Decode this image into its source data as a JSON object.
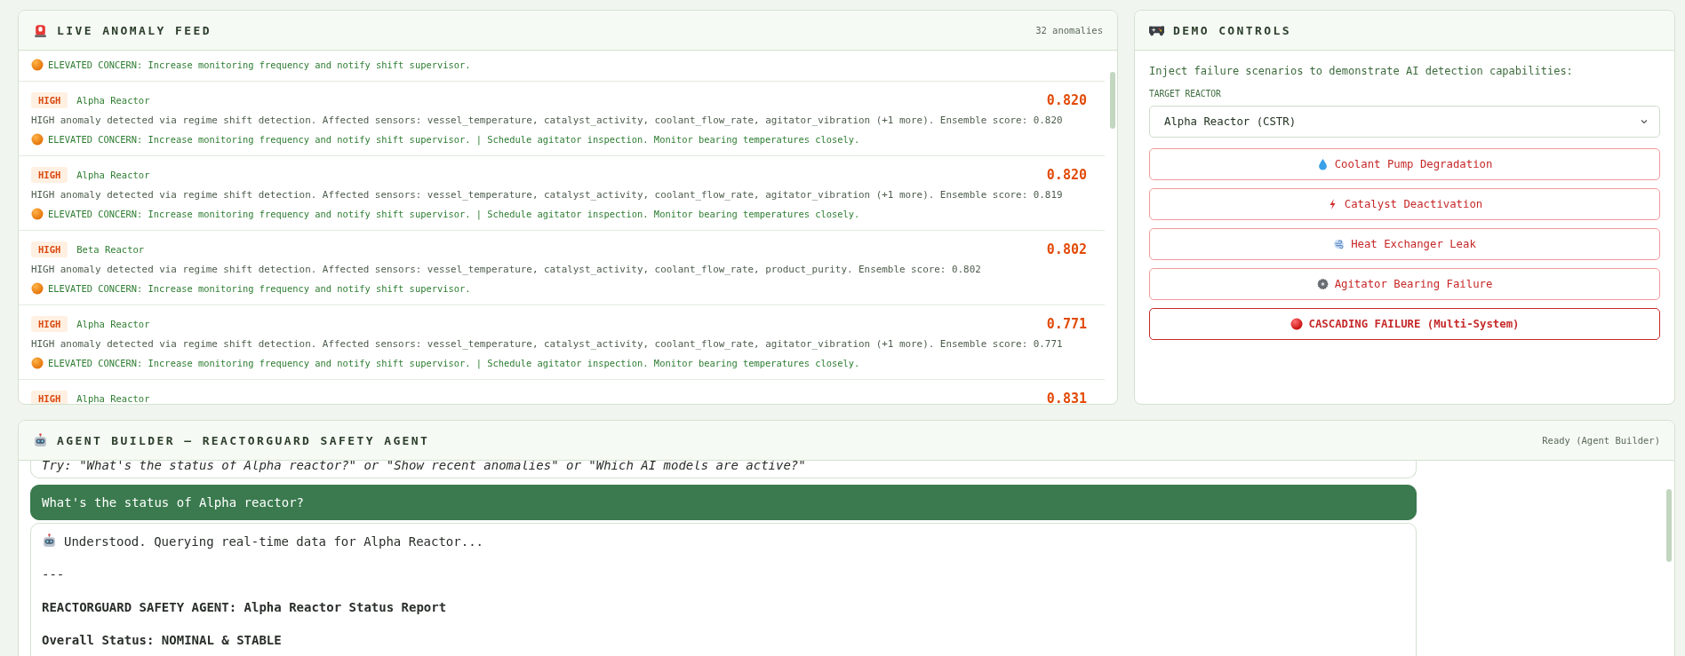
{
  "feed": {
    "title": "LIVE ANOMALY FEED",
    "count": "32 anomalies",
    "items": [
      {
        "concern": "ELEVATED CONCERN: Increase monitoring frequency and notify shift supervisor."
      },
      {
        "severity": "HIGH",
        "reactor": "Alpha Reactor",
        "score": "0.820",
        "description": "HIGH anomaly detected via regime shift detection. Affected sensors: vessel_temperature, catalyst_activity, coolant_flow_rate, agitator_vibration (+1 more). Ensemble score: 0.820",
        "concern": "ELEVATED CONCERN: Increase monitoring frequency and notify shift supervisor. | Schedule agitator inspection. Monitor bearing temperatures closely."
      },
      {
        "severity": "HIGH",
        "reactor": "Alpha Reactor",
        "score": "0.820",
        "description": "HIGH anomaly detected via regime shift detection. Affected sensors: vessel_temperature, catalyst_activity, coolant_flow_rate, agitator_vibration (+1 more). Ensemble score: 0.819",
        "concern": "ELEVATED CONCERN: Increase monitoring frequency and notify shift supervisor. | Schedule agitator inspection. Monitor bearing temperatures closely."
      },
      {
        "severity": "HIGH",
        "reactor": "Beta Reactor",
        "score": "0.802",
        "description": "HIGH anomaly detected via regime shift detection. Affected sensors: vessel_temperature, catalyst_activity, coolant_flow_rate, product_purity. Ensemble score: 0.802",
        "concern": "ELEVATED CONCERN: Increase monitoring frequency and notify shift supervisor."
      },
      {
        "severity": "HIGH",
        "reactor": "Alpha Reactor",
        "score": "0.771",
        "description": "HIGH anomaly detected via regime shift detection. Affected sensors: vessel_temperature, catalyst_activity, coolant_flow_rate, agitator_vibration (+1 more). Ensemble score: 0.771",
        "concern": "ELEVATED CONCERN: Increase monitoring frequency and notify shift supervisor. | Schedule agitator inspection. Monitor bearing temperatures closely."
      },
      {
        "severity": "HIGH",
        "reactor": "Alpha Reactor",
        "score": "0.831"
      }
    ]
  },
  "controls": {
    "title": "DEMO CONTROLS",
    "intro": "Inject failure scenarios to demonstrate AI detection capabilities:",
    "target_label": "TARGET REACTOR",
    "target_value": "Alpha Reactor (CSTR)",
    "buttons": [
      {
        "label": "Coolant Pump Degradation",
        "kind": "scenario"
      },
      {
        "label": "Catalyst Deactivation",
        "kind": "scenario"
      },
      {
        "label": "Heat Exchanger Leak",
        "kind": "scenario"
      },
      {
        "label": "Agitator Bearing Failure",
        "kind": "scenario"
      },
      {
        "label": "CASCADING FAILURE (Multi-System)",
        "kind": "critical"
      }
    ]
  },
  "agent": {
    "title": "AGENT BUILDER — REACTORGUARD SAFETY AGENT",
    "status": "Ready (Agent Builder)",
    "messages": [
      {
        "kind": "hint",
        "lines": [
          {
            "kind": "italic",
            "text": "Try: \"What's the status of Alpha reactor?\" or \"Show recent anomalies\" or \"Which AI models are active?\""
          }
        ]
      },
      {
        "kind": "user",
        "lines": [
          {
            "kind": "plain",
            "text": "What's the status of Alpha reactor?"
          }
        ]
      },
      {
        "kind": "bot",
        "lines": [
          {
            "kind": "plain",
            "text": "Understood. Querying real-time data for Alpha Reactor..."
          },
          {
            "kind": "plain",
            "text": "---"
          },
          {
            "kind": "bold",
            "text": "REACTORGUARD SAFETY AGENT: Alpha Reactor Status Report"
          },
          {
            "kind": "bold",
            "text": "Overall Status: NOMINAL & STABLE"
          }
        ]
      }
    ]
  }
}
